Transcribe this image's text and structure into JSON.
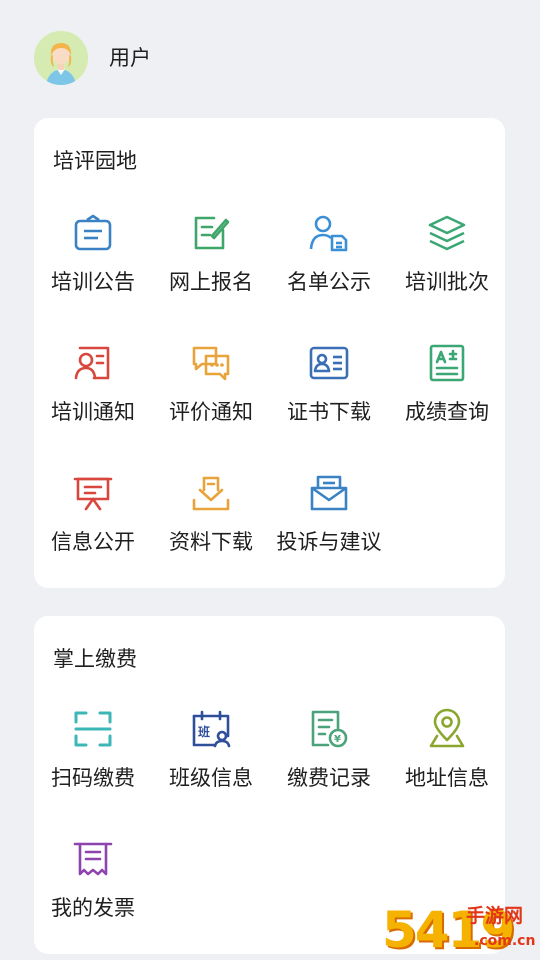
{
  "header": {
    "username": "用户"
  },
  "section_training": {
    "title": "培评园地",
    "items": [
      {
        "label": "培训公告",
        "icon": "announcement-briefcase-icon",
        "color": "#3b82c4"
      },
      {
        "label": "网上报名",
        "icon": "edit-form-icon",
        "color": "#3fa66a"
      },
      {
        "label": "名单公示",
        "icon": "person-list-icon",
        "color": "#3b8fd6"
      },
      {
        "label": "培训批次",
        "icon": "layers-icon",
        "color": "#3aa774"
      },
      {
        "label": "培训通知",
        "icon": "notice-profile-icon",
        "color": "#d8473e"
      },
      {
        "label": "评价通知",
        "icon": "chat-bubbles-icon",
        "color": "#e8a33a"
      },
      {
        "label": "证书下载",
        "icon": "id-card-icon",
        "color": "#3a6fb5"
      },
      {
        "label": "成绩查询",
        "icon": "grade-sheet-icon",
        "color": "#3aa774"
      },
      {
        "label": "信息公开",
        "icon": "presentation-board-icon",
        "color": "#d8473e"
      },
      {
        "label": "资料下载",
        "icon": "download-tray-icon",
        "color": "#e8a33a"
      },
      {
        "label": "投诉与建议",
        "icon": "mail-envelope-icon",
        "color": "#3b82c4"
      }
    ]
  },
  "section_payment": {
    "title": "掌上缴费",
    "items": [
      {
        "label": "扫码缴费",
        "icon": "scan-code-icon",
        "color": "#3cb6b6"
      },
      {
        "label": "班级信息",
        "icon": "class-calendar-icon",
        "color": "#2f4f9a",
        "badge": "班"
      },
      {
        "label": "缴费记录",
        "icon": "payment-record-icon",
        "color": "#4aa37a",
        "badge": "¥"
      },
      {
        "label": "地址信息",
        "icon": "location-pin-icon",
        "color": "#8aa62d"
      },
      {
        "label": "我的发票",
        "icon": "invoice-receipt-icon",
        "color": "#8e44ad"
      }
    ]
  },
  "watermark": {
    "digits": "5419",
    "site": "手游网",
    "domain": ".com.cn"
  }
}
